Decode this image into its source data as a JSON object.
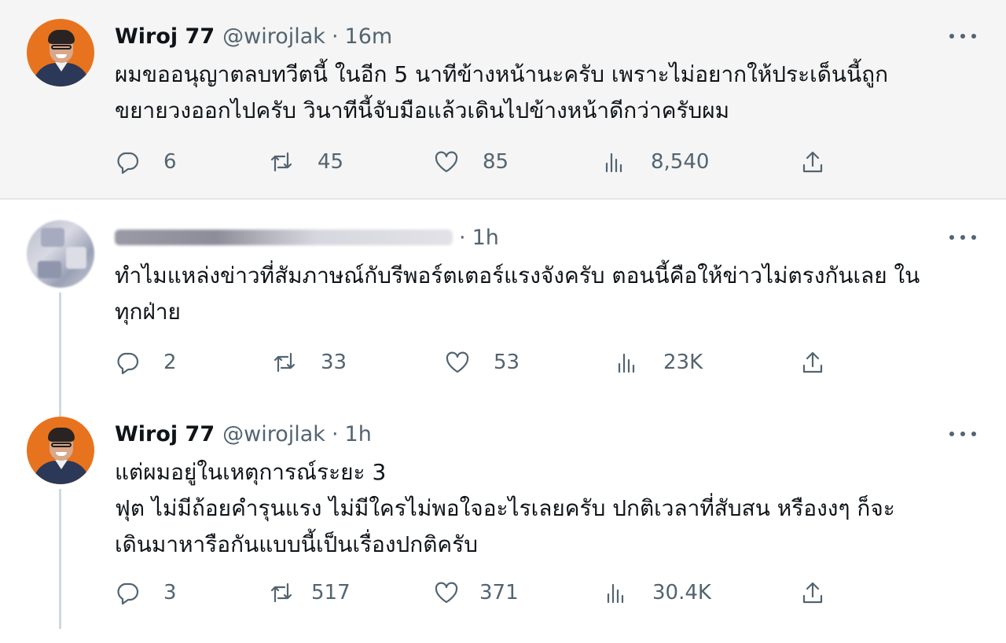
{
  "tweets": [
    {
      "name": "Wiroj 77",
      "handle": "@wirojlak",
      "separator": "·",
      "time": "16m",
      "text": "ผมขออนุญาตลบทวีตนี้ ในอีก 5 นาทีข้างหน้านะครับ เพราะไม่อยากให้ประเด็นนี้ถูก\nขยายวงออกไปครับ วินาทีนี้จับมือแล้วเดินไปข้างหน้าดีกว่าครับผม",
      "replies": "6",
      "retweets": "45",
      "likes": "85",
      "views": "8,540"
    },
    {
      "name": "",
      "handle": "",
      "separator": "·",
      "time": "1h",
      "text": "ทำไมแหล่งข่าวที่สัมภาษณ์กับรีพอร์ตเตอร์แรงจังครับ ตอนนี้คือให้ข่าวไม่ตรงกันเลย ใน\nทุกฝ่าย",
      "replies": "2",
      "retweets": "33",
      "likes": "53",
      "views": "23K"
    },
    {
      "name": "Wiroj 77",
      "handle": "@wirojlak",
      "separator": "·",
      "time": "1h",
      "text": "แต่ผมอยู่ในเหตุการณ์ระยะ 3\nฟุต ไม่มีถ้อยคำรุนแรง ไม่มีใครไม่พอใจอะไรเลยครับ ปกติเวลาที่สับสน หรืองงๆ ก็จะ\nเดินมาหารือกันแบบนี้เป็นเรื่องปกติครับ",
      "replies": "3",
      "retweets": "517",
      "likes": "371",
      "views": "30.4K"
    }
  ],
  "colors": {
    "highlight_bg": "#f5f5f5",
    "secondary_text": "#536471",
    "primary_text": "#0f1419",
    "thread_line": "#cfd9de",
    "avatar_bg": "#e8731e"
  }
}
